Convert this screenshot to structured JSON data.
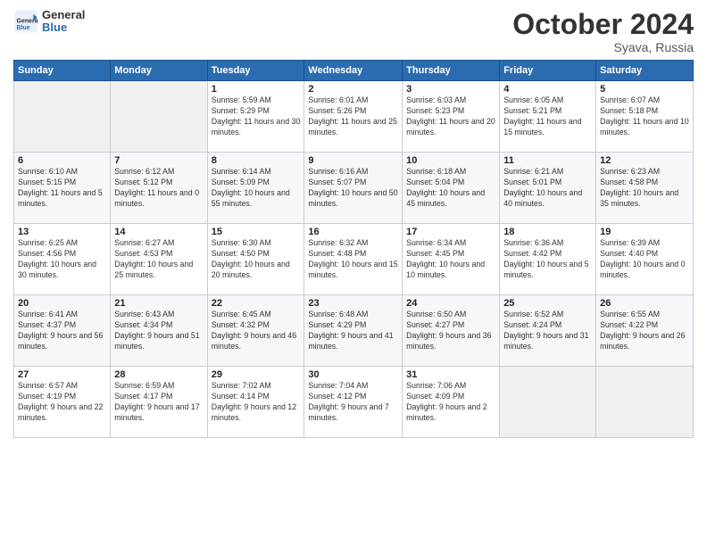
{
  "header": {
    "logo_line1": "General",
    "logo_line2": "Blue",
    "month": "October 2024",
    "location": "Syava, Russia"
  },
  "weekdays": [
    "Sunday",
    "Monday",
    "Tuesday",
    "Wednesday",
    "Thursday",
    "Friday",
    "Saturday"
  ],
  "weeks": [
    [
      {
        "day": "",
        "info": ""
      },
      {
        "day": "",
        "info": ""
      },
      {
        "day": "1",
        "info": "Sunrise: 5:59 AM\nSunset: 5:29 PM\nDaylight: 11 hours and 30 minutes."
      },
      {
        "day": "2",
        "info": "Sunrise: 6:01 AM\nSunset: 5:26 PM\nDaylight: 11 hours and 25 minutes."
      },
      {
        "day": "3",
        "info": "Sunrise: 6:03 AM\nSunset: 5:23 PM\nDaylight: 11 hours and 20 minutes."
      },
      {
        "day": "4",
        "info": "Sunrise: 6:05 AM\nSunset: 5:21 PM\nDaylight: 11 hours and 15 minutes."
      },
      {
        "day": "5",
        "info": "Sunrise: 6:07 AM\nSunset: 5:18 PM\nDaylight: 11 hours and 10 minutes."
      }
    ],
    [
      {
        "day": "6",
        "info": "Sunrise: 6:10 AM\nSunset: 5:15 PM\nDaylight: 11 hours and 5 minutes."
      },
      {
        "day": "7",
        "info": "Sunrise: 6:12 AM\nSunset: 5:12 PM\nDaylight: 11 hours and 0 minutes."
      },
      {
        "day": "8",
        "info": "Sunrise: 6:14 AM\nSunset: 5:09 PM\nDaylight: 10 hours and 55 minutes."
      },
      {
        "day": "9",
        "info": "Sunrise: 6:16 AM\nSunset: 5:07 PM\nDaylight: 10 hours and 50 minutes."
      },
      {
        "day": "10",
        "info": "Sunrise: 6:18 AM\nSunset: 5:04 PM\nDaylight: 10 hours and 45 minutes."
      },
      {
        "day": "11",
        "info": "Sunrise: 6:21 AM\nSunset: 5:01 PM\nDaylight: 10 hours and 40 minutes."
      },
      {
        "day": "12",
        "info": "Sunrise: 6:23 AM\nSunset: 4:58 PM\nDaylight: 10 hours and 35 minutes."
      }
    ],
    [
      {
        "day": "13",
        "info": "Sunrise: 6:25 AM\nSunset: 4:56 PM\nDaylight: 10 hours and 30 minutes."
      },
      {
        "day": "14",
        "info": "Sunrise: 6:27 AM\nSunset: 4:53 PM\nDaylight: 10 hours and 25 minutes."
      },
      {
        "day": "15",
        "info": "Sunrise: 6:30 AM\nSunset: 4:50 PM\nDaylight: 10 hours and 20 minutes."
      },
      {
        "day": "16",
        "info": "Sunrise: 6:32 AM\nSunset: 4:48 PM\nDaylight: 10 hours and 15 minutes."
      },
      {
        "day": "17",
        "info": "Sunrise: 6:34 AM\nSunset: 4:45 PM\nDaylight: 10 hours and 10 minutes."
      },
      {
        "day": "18",
        "info": "Sunrise: 6:36 AM\nSunset: 4:42 PM\nDaylight: 10 hours and 5 minutes."
      },
      {
        "day": "19",
        "info": "Sunrise: 6:39 AM\nSunset: 4:40 PM\nDaylight: 10 hours and 0 minutes."
      }
    ],
    [
      {
        "day": "20",
        "info": "Sunrise: 6:41 AM\nSunset: 4:37 PM\nDaylight: 9 hours and 56 minutes."
      },
      {
        "day": "21",
        "info": "Sunrise: 6:43 AM\nSunset: 4:34 PM\nDaylight: 9 hours and 51 minutes."
      },
      {
        "day": "22",
        "info": "Sunrise: 6:45 AM\nSunset: 4:32 PM\nDaylight: 9 hours and 46 minutes."
      },
      {
        "day": "23",
        "info": "Sunrise: 6:48 AM\nSunset: 4:29 PM\nDaylight: 9 hours and 41 minutes."
      },
      {
        "day": "24",
        "info": "Sunrise: 6:50 AM\nSunset: 4:27 PM\nDaylight: 9 hours and 36 minutes."
      },
      {
        "day": "25",
        "info": "Sunrise: 6:52 AM\nSunset: 4:24 PM\nDaylight: 9 hours and 31 minutes."
      },
      {
        "day": "26",
        "info": "Sunrise: 6:55 AM\nSunset: 4:22 PM\nDaylight: 9 hours and 26 minutes."
      }
    ],
    [
      {
        "day": "27",
        "info": "Sunrise: 6:57 AM\nSunset: 4:19 PM\nDaylight: 9 hours and 22 minutes."
      },
      {
        "day": "28",
        "info": "Sunrise: 6:59 AM\nSunset: 4:17 PM\nDaylight: 9 hours and 17 minutes."
      },
      {
        "day": "29",
        "info": "Sunrise: 7:02 AM\nSunset: 4:14 PM\nDaylight: 9 hours and 12 minutes."
      },
      {
        "day": "30",
        "info": "Sunrise: 7:04 AM\nSunset: 4:12 PM\nDaylight: 9 hours and 7 minutes."
      },
      {
        "day": "31",
        "info": "Sunrise: 7:06 AM\nSunset: 4:09 PM\nDaylight: 9 hours and 2 minutes."
      },
      {
        "day": "",
        "info": ""
      },
      {
        "day": "",
        "info": ""
      }
    ]
  ]
}
